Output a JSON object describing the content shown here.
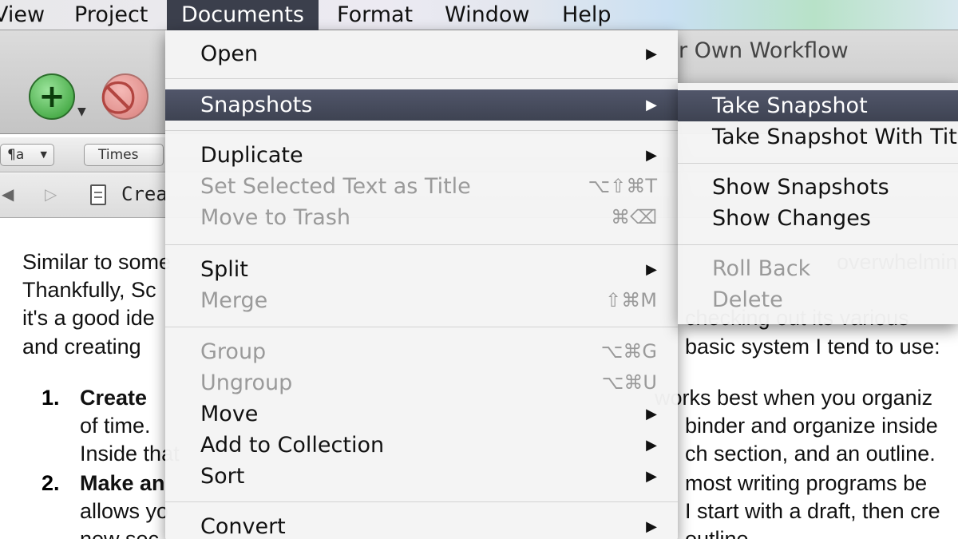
{
  "menubar": {
    "items": [
      "View",
      "Project",
      "Documents",
      "Format",
      "Window",
      "Help"
    ],
    "active": "Documents"
  },
  "window": {
    "title": "r Own Workflow",
    "add_icon": "+",
    "stop_icon": "⃠",
    "format_style": "¶a",
    "format_font": "Times",
    "breadcrumb": "Crea"
  },
  "documents_menu": {
    "open": "Open",
    "snapshots": "Snapshots",
    "duplicate": "Duplicate",
    "set_title": "Set Selected Text as Title",
    "set_title_shortcut": "⌥⇧⌘T",
    "move_to_trash": "Move to Trash",
    "move_to_trash_shortcut": "⌘⌫",
    "split": "Split",
    "merge": "Merge",
    "merge_shortcut": "⇧⌘M",
    "group": "Group",
    "group_shortcut": "⌥⌘G",
    "ungroup": "Ungroup",
    "ungroup_shortcut": "⌥⌘U",
    "move": "Move",
    "add_to_collection": "Add to Collection",
    "sort": "Sort",
    "convert": "Convert",
    "submenu_arrow": "▶"
  },
  "snapshots_submenu": {
    "take_snapshot": "Take Snapshot",
    "take_snapshot_with_title": "Take Snapshot With Title",
    "show_snapshots": "Show Snapshots",
    "show_changes": "Show Changes",
    "roll_back": "Roll Back",
    "delete": "Delete"
  },
  "document": {
    "line1a": "Similar to some",
    "line1b": "overwhelming",
    "line2": "Thankfully, Sc",
    "line3a": "it's a good ide",
    "line3b": "checking out its various",
    "line4a": "and creating",
    "line4b": "basic system I tend to use:",
    "item1_num": "1.",
    "item1_bold": "Create",
    "item1_rest": "works best when you organiz",
    "item1_line2a": "of time.",
    "item1_line2b": "binder and organize inside",
    "item1_line3a": "Inside that",
    "item1_line3b": "ch section, and an outline.",
    "item2_num": "2.",
    "item2_bold": "Make an",
    "item2_rest": "most writing programs be",
    "item2_line2a": "allows yo",
    "item2_line2b": "I start with a draft, then cre",
    "item2_line3a": "new sec",
    "item2_line3b": "outline"
  }
}
